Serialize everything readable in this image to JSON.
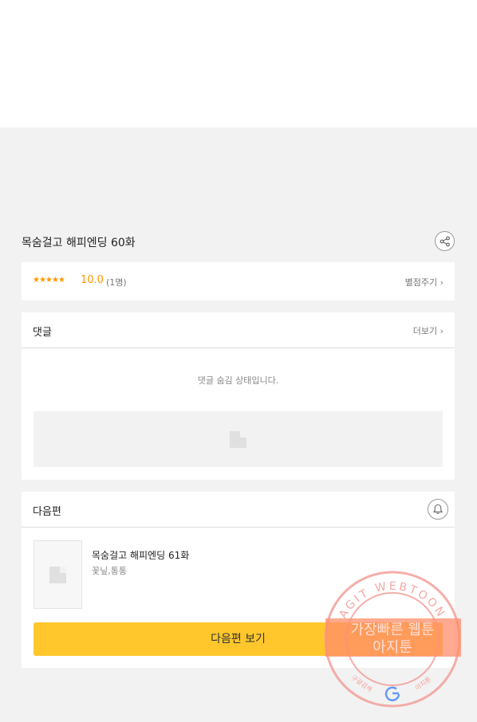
{
  "episode": {
    "title": "목숨걸고 해피엔딩 60화",
    "share_icon": "share-icon"
  },
  "rating": {
    "stars": "★★★★★",
    "score": "10.0",
    "count": "(1명)",
    "rate_link": "별점주기",
    "star_color": "#ff9900"
  },
  "comments": {
    "label": "댓글",
    "more_link": "더보기",
    "hidden_message": "댓글 숨김 상태입니다."
  },
  "next": {
    "label": "다음편",
    "bell_icon": "bell-icon",
    "title": "목숨걸고 해피엔딩 61화",
    "author": "꽃닢,통통",
    "button": "다음편 보기",
    "button_color": "#ffc72c"
  },
  "watermark": {
    "arc_text": "AGIT WEBTOON",
    "line1": "가장빠른 웹툰",
    "line2": "아지툰",
    "bottom_left": "구글검색",
    "bottom_right": "아지툰"
  }
}
